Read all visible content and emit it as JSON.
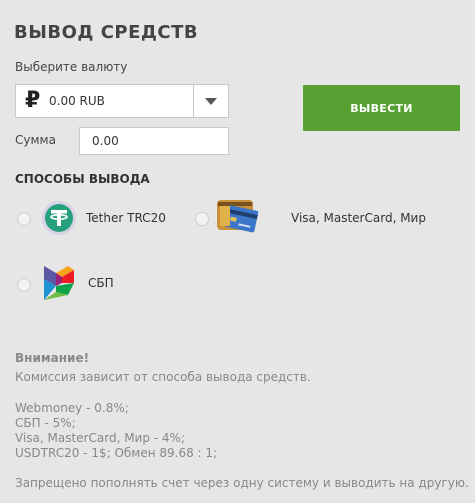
{
  "title": "ВЫВОД СРЕДСТВ",
  "currency": {
    "label": "Выберите валюту",
    "symbol": "₽",
    "value": "0.00 RUB"
  },
  "withdraw_button": "ВЫВЕСТИ",
  "amount": {
    "label": "Сумма",
    "value": "0.00"
  },
  "methods": {
    "title": "СПОСОБЫ ВЫВОДА",
    "items": [
      {
        "label": "Tether TRC20",
        "icon": "tether-icon"
      },
      {
        "label": "Visa, MasterCard, Мир",
        "icon": "bank-cards-icon"
      },
      {
        "label": "СБП",
        "icon": "sbp-icon"
      }
    ]
  },
  "notice": {
    "heading": "Внимание!",
    "commission_note": "Комиссия зависит от способа вывода средств.",
    "fees": [
      "Webmoney - 0.8%;",
      "СБП - 5%;",
      "Visa, MasterCard, Мир - 4%;",
      "USDTRC20 - 1$; Обмен 89.68 : 1;"
    ],
    "warning": "Запрещено пополнять счет через одну систему и выводить на другую."
  },
  "colors": {
    "background": "#e6e6e6",
    "button": "#57a032",
    "tether": "#26a17b"
  }
}
